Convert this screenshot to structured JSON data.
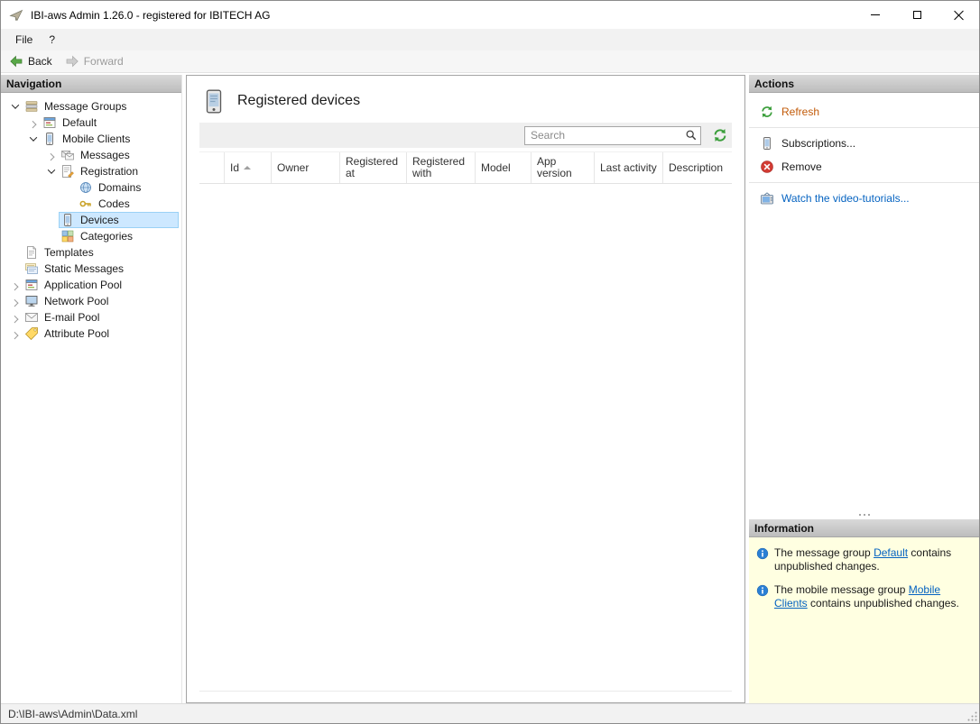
{
  "window": {
    "title": "IBI-aws Admin 1.26.0 - registered for IBITECH AG"
  },
  "menubar": {
    "file": "File",
    "help": "?"
  },
  "toolbar": {
    "back": "Back",
    "forward": "Forward"
  },
  "navigation": {
    "header": "Navigation",
    "tree": [
      {
        "label": "Message Groups"
      },
      {
        "label": "Default"
      },
      {
        "label": "Mobile Clients"
      },
      {
        "label": "Messages"
      },
      {
        "label": "Registration"
      },
      {
        "label": "Domains"
      },
      {
        "label": "Codes"
      },
      {
        "label": "Devices"
      },
      {
        "label": "Categories"
      },
      {
        "label": "Templates"
      },
      {
        "label": "Static Messages"
      },
      {
        "label": "Application Pool"
      },
      {
        "label": "Network Pool"
      },
      {
        "label": "E-mail Pool"
      },
      {
        "label": "Attribute Pool"
      }
    ]
  },
  "main": {
    "title": "Registered devices",
    "search_placeholder": "Search",
    "table": {
      "columns": [
        "Id",
        "Owner",
        "Registered at",
        "Registered with",
        "Model",
        "App version",
        "Last activity",
        "Description"
      ],
      "rows": []
    }
  },
  "actions": {
    "header": "Actions",
    "refresh": "Refresh",
    "subscriptions": "Subscriptions...",
    "remove": "Remove",
    "video": "Watch the video-tutorials..."
  },
  "information": {
    "header": "Information",
    "items": [
      {
        "text_before": "The message group ",
        "link": "Default",
        "text_after": " contains unpublished changes."
      },
      {
        "text_before": "The mobile message group ",
        "link": "Mobile Clients",
        "text_after": " contains unpublished changes."
      }
    ]
  },
  "statusbar": {
    "path": "D:\\IBI-aws\\Admin\\Data.xml"
  },
  "colors": {
    "selection_bg": "#cde8ff",
    "link_blue": "#0563c1",
    "refresh_link_orange": "#c25a08",
    "info_panel_bg": "#ffffe1",
    "panel_header_gray": "#bdbdbd"
  },
  "icons": {
    "app-icon": "paper-plane-logo",
    "back-icon": "green-left-arrow",
    "forward-icon": "gray-right-arrow-disabled",
    "search-icon": "magnifier",
    "refresh-icon": "green-circular-arrows",
    "subscriptions-icon": "mobile-device",
    "remove-icon": "red-circle-x",
    "video-tutorials-icon": "television",
    "info-icon": "blue-info-circle",
    "sort-ascending-icon": "up-triangle",
    "registered-devices-icon": "mobile-device"
  }
}
